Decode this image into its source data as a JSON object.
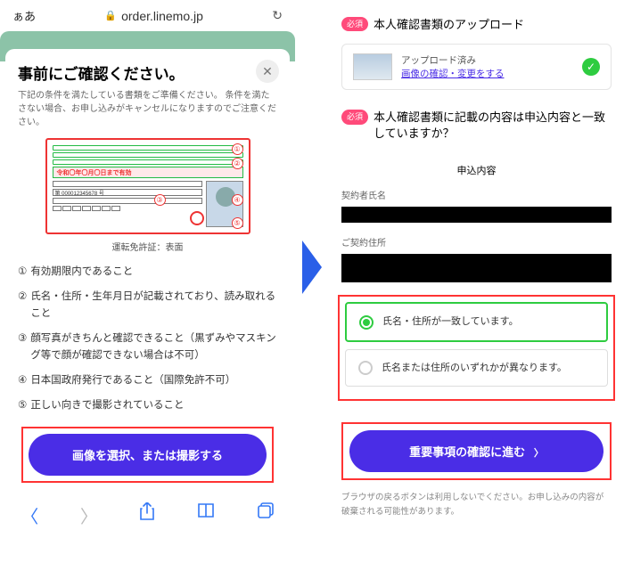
{
  "left": {
    "safari": {
      "aa": "ぁあ",
      "url": "order.linemo.jp"
    },
    "modal": {
      "title": "事前にご確認ください。",
      "subtitle": "下記の条件を満たしている書類をご準備ください。\n条件を満たさない場合、お申し込みがキャンセルになりますのでご注意ください。",
      "license": {
        "valid_text": "令和〇年〇月〇日まで有効",
        "number": "第 000012345678 号",
        "caption": "運転免許証：表面",
        "markers": [
          "①",
          "②",
          "③",
          "④",
          "⑤"
        ]
      },
      "rules": [
        {
          "n": "①",
          "t": "有効期限内であること"
        },
        {
          "n": "②",
          "t": "氏名・住所・生年月日が記載されており、読み取れること"
        },
        {
          "n": "③",
          "t": "顔写真がきちんと確認できること（黒ずみやマスキング等で顔が確認できない場合は不可）"
        },
        {
          "n": "④",
          "t": "日本国政府発行であること（国際免許不可）"
        },
        {
          "n": "⑤",
          "t": "正しい向きで撮影されていること"
        }
      ],
      "cta": "画像を選択、または撮影する"
    }
  },
  "right": {
    "badge": "必須",
    "upload": {
      "heading": "本人確認書類のアップロード",
      "done_label": "アップロード済み",
      "link": "画像の確認・変更をする"
    },
    "match": {
      "heading": "本人確認書類に記載の内容は申込内容と一致していますか？",
      "content_title": "申込内容",
      "field1": "契約者氏名",
      "field2": "ご契約住所",
      "radio1": "氏名・住所が一致しています。",
      "radio2": "氏名または住所のいずれかが異なります。"
    },
    "cta": "重要事項の確認に進む",
    "footer": "ブラウザの戻るボタンは利用しないでください。お申し込みの内容が破棄される可能性があります。"
  }
}
